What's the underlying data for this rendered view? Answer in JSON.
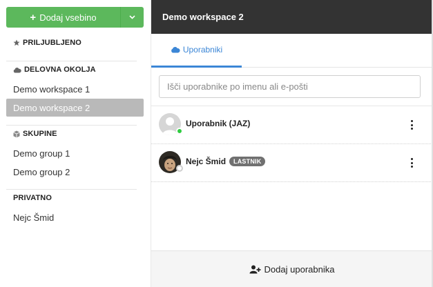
{
  "sidebar": {
    "add_button_label": "Dodaj vsebino",
    "sections": {
      "favorites": {
        "title": "PRILJUBLJENO",
        "icon": "star-icon"
      },
      "workspaces": {
        "title": "DELOVNA OKOLJA",
        "icon": "cloud-icon",
        "items": [
          {
            "label": "Demo workspace 1",
            "active": false
          },
          {
            "label": "Demo workspace 2",
            "active": true
          }
        ]
      },
      "groups": {
        "title": "SKUPINE",
        "icon": "cube-icon",
        "items": [
          {
            "label": "Demo group 1"
          },
          {
            "label": "Demo group 2"
          }
        ]
      },
      "private": {
        "title": "PRIVATNO",
        "items": [
          {
            "label": "Nejc Šmid"
          }
        ]
      }
    }
  },
  "panel": {
    "header_title": "Demo workspace 2",
    "tabs": [
      {
        "label": "Uporabniki",
        "icon": "cloud-icon",
        "active": true
      }
    ],
    "search": {
      "value": "",
      "placeholder": "Išči uporabnike po imenu ali e-pošti"
    },
    "users": [
      {
        "name": "Uporabnik (JAZ)",
        "badge": "",
        "status": "online",
        "avatar": "default-avatar"
      },
      {
        "name": "Nejc Šmid",
        "badge": "LASTNIK",
        "status": "offline",
        "avatar": "photo-avatar"
      }
    ],
    "footer_button_label": "Dodaj uporabnika"
  },
  "colors": {
    "primary_green": "#5cb85c",
    "header_dark": "#333333",
    "tab_blue": "#3b86d6",
    "active_item_gray": "#b9b9b9",
    "online_green": "#2ecc40",
    "badge_gray": "#707070"
  }
}
